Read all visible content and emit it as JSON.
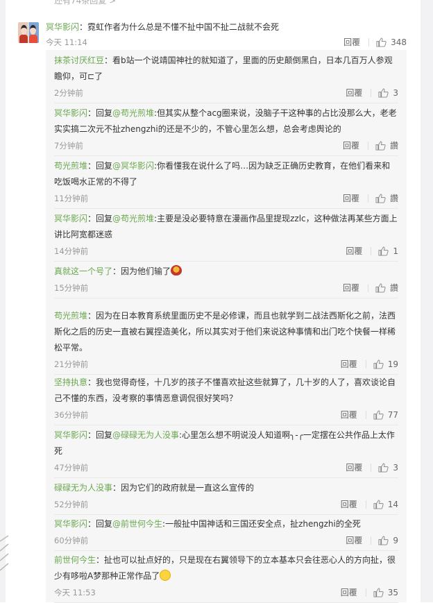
{
  "top_strip_text": "还有74条回复 >",
  "top_comment": {
    "user": "冥华影闪",
    "text": "：霓虹作者为什么总是不懂不扯中国不扯二战就不会死",
    "time": "今天 11:14",
    "reply_label": "回覆",
    "likes": "348"
  },
  "replies": [
    {
      "user": "抹茶讨厌红豆",
      "text": "：看b站一个说靖国神社的就知道了，里面的历史颠倒黑白，日本几百万人参观瞻仰，可⊏了",
      "time": "2分钟前",
      "reply_label": "回覆",
      "likes": "3"
    },
    {
      "user": "冥华影闪",
      "prefix": "：回复",
      "mention": "@苟光煎堆",
      "text": ":但其实从整个acg圈来说，没脑子干这种事的占比没那么大，老老实实搞二次元不扯zhengzhi的还是不少的，不管心里怎么想，总会考虑舆论的",
      "time": "7分钟前",
      "reply_label": "回覆",
      "likes": "讚"
    },
    {
      "user": "苟光煎堆",
      "prefix": "：回复",
      "mention": "@冥华影闪",
      "text": ":你看懂我在说什么了吗…因为缺乏正确历史教育，在他们看来和吃饭喝水正常的不得了",
      "time": "11分钟前",
      "reply_label": "回覆",
      "likes": "讚"
    },
    {
      "user": "冥华影闪",
      "prefix": "：回复",
      "mention": "@苟光煎堆",
      "text": ":主要是没必要特意在漫画作品里提现zzlc，这种做法再某些方面上讲比阿宽都迷惑",
      "time": "14分钟前",
      "reply_label": "回覆",
      "likes": "1"
    },
    {
      "user": "真就这一个号了",
      "text": "：因为他们输了",
      "emoji": "boat",
      "time": "15分钟前",
      "reply_label": "回覆",
      "likes": "讚"
    },
    {
      "user": "苟光煎堆",
      "text": "：因为在日本教育系统里面历史不是必修课，而且也就学到二战法西斯化之前，法西斯化之后的历史一直被右翼捏造美化，所以其实对于他们来说这种事情和出门吃个快餐一样稀松平常。",
      "time": "21分钟前",
      "reply_label": "回覆",
      "likes": "19"
    },
    {
      "user": "坚持执意",
      "text": "：我也觉得奇怪，十几岁的孩子不懂喜欢扯这些就算了，几十岁的人了，喜欢谈论自己不懂的东西，没考察的事情恶意调侃很好笑吗？",
      "time": "36分钟前",
      "reply_label": "回覆",
      "likes": "77"
    },
    {
      "user": "冥华影闪",
      "prefix": "：回复",
      "mention": "@碌碌无为人没事",
      "text": ":心里怎么想不明说没人知道啊╮-╭一定摆在公共作品上太作死",
      "time": "47分钟前",
      "reply_label": "回覆",
      "likes": "3"
    },
    {
      "user": "碌碌无为人没事",
      "text": "：因为它们的政府就是一直这么宣传的",
      "time": "52分钟前",
      "reply_label": "回覆",
      "likes": "14"
    },
    {
      "user": "冥华影闪",
      "prefix": "：回复",
      "mention": "@前世何今生",
      "text": ":一般扯中国神话和三国还安全点，扯zhengzhi的全死",
      "time": "60分钟前",
      "reply_label": "回覆",
      "likes": "9"
    },
    {
      "user": "前世何今生",
      "text": "：扯也可以扯点好的，只是现在右翼领导下的立本基本只会往恶心人的方向扯，很少有哆啦A梦那种正常作品了",
      "emoji": "smile",
      "time": "今天 11:53",
      "reply_label": "回覆",
      "likes": "35"
    }
  ],
  "colors": {
    "username": "#6aa84f",
    "time": "#999999",
    "reply_bg": "#f6f6f6"
  }
}
